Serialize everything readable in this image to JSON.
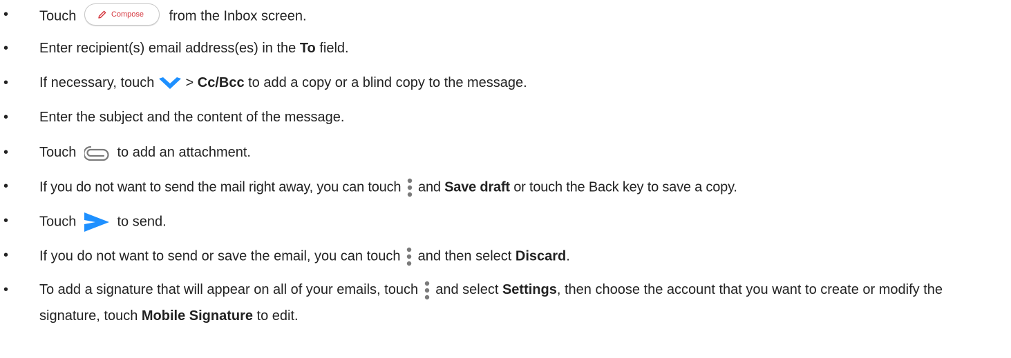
{
  "bullet_char": "•",
  "compose_label": "Compose",
  "colors": {
    "accent": "#d4343c",
    "icon_blue": "#1e90ff",
    "icon_gray": "#7a7a7a"
  },
  "items": [
    {
      "before": "Touch",
      "after": "from the Inbox screen."
    },
    {
      "before": "Enter recipient(s) email address(es) in the ",
      "bold": "To",
      "after": " field."
    },
    {
      "before": "If necessary, touch",
      "middle": " > ",
      "bold": "Cc/Bcc",
      "after": " to add a copy or a blind copy to the message."
    },
    {
      "before": "Enter the subject and the content of the message."
    },
    {
      "before": "Touch",
      "after": "to add an attachment."
    },
    {
      "before": "If you do not want to send the mail right away, you can touch",
      "bold": "Save draft",
      "middle": " and ",
      "after": " or touch the Back key to save a copy."
    },
    {
      "before": "Touch",
      "after": "to send."
    },
    {
      "before": "If you do not want to send or save the email, you can touch",
      "middle": " and then select ",
      "bold": "Discard",
      "after": "."
    },
    {
      "before": "To add a signature that will appear on all of your emails, touch",
      "middle": " and select ",
      "bold": "Settings",
      "after": ", then choose the account that you want to create or modify the signature, touch ",
      "bold2": "Mobile Signature",
      "after2": " to edit."
    }
  ]
}
